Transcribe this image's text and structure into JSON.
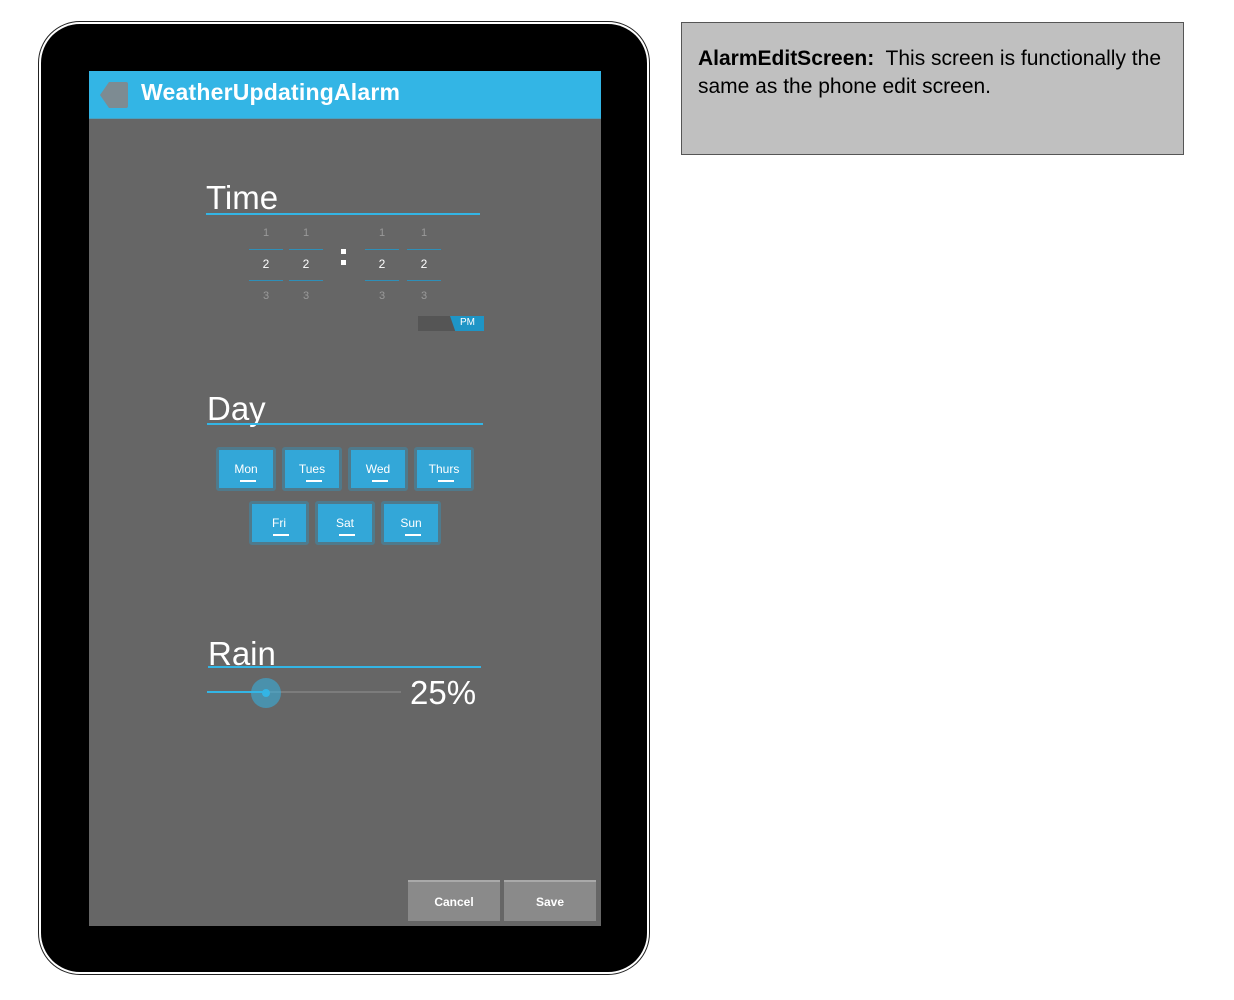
{
  "app": {
    "title": "WeatherUpdatingAlarm"
  },
  "time": {
    "heading": "Time",
    "columns": [
      {
        "above": "1",
        "current": "2",
        "below": "3"
      },
      {
        "above": "1",
        "current": "2",
        "below": "3"
      },
      {
        "above": "1",
        "current": "2",
        "below": "3"
      },
      {
        "above": "1",
        "current": "2",
        "below": "3"
      }
    ],
    "ampm": "PM"
  },
  "day": {
    "heading": "Day",
    "buttons": [
      "Mon",
      "Tues",
      "Wed",
      "Thurs",
      "Fri",
      "Sat",
      "Sun"
    ]
  },
  "rain": {
    "heading": "Rain",
    "value_label": "25%",
    "fraction": 0.25
  },
  "footer": {
    "cancel_label": "Cancel",
    "save_label": "Save"
  },
  "note": {
    "title": "AlarmEditScreen:",
    "body": "This screen is functionally the same as the phone edit screen."
  },
  "colors": {
    "accent": "#33b5e5",
    "screen_bg": "#666666",
    "note_bg": "#c0c0c0"
  }
}
